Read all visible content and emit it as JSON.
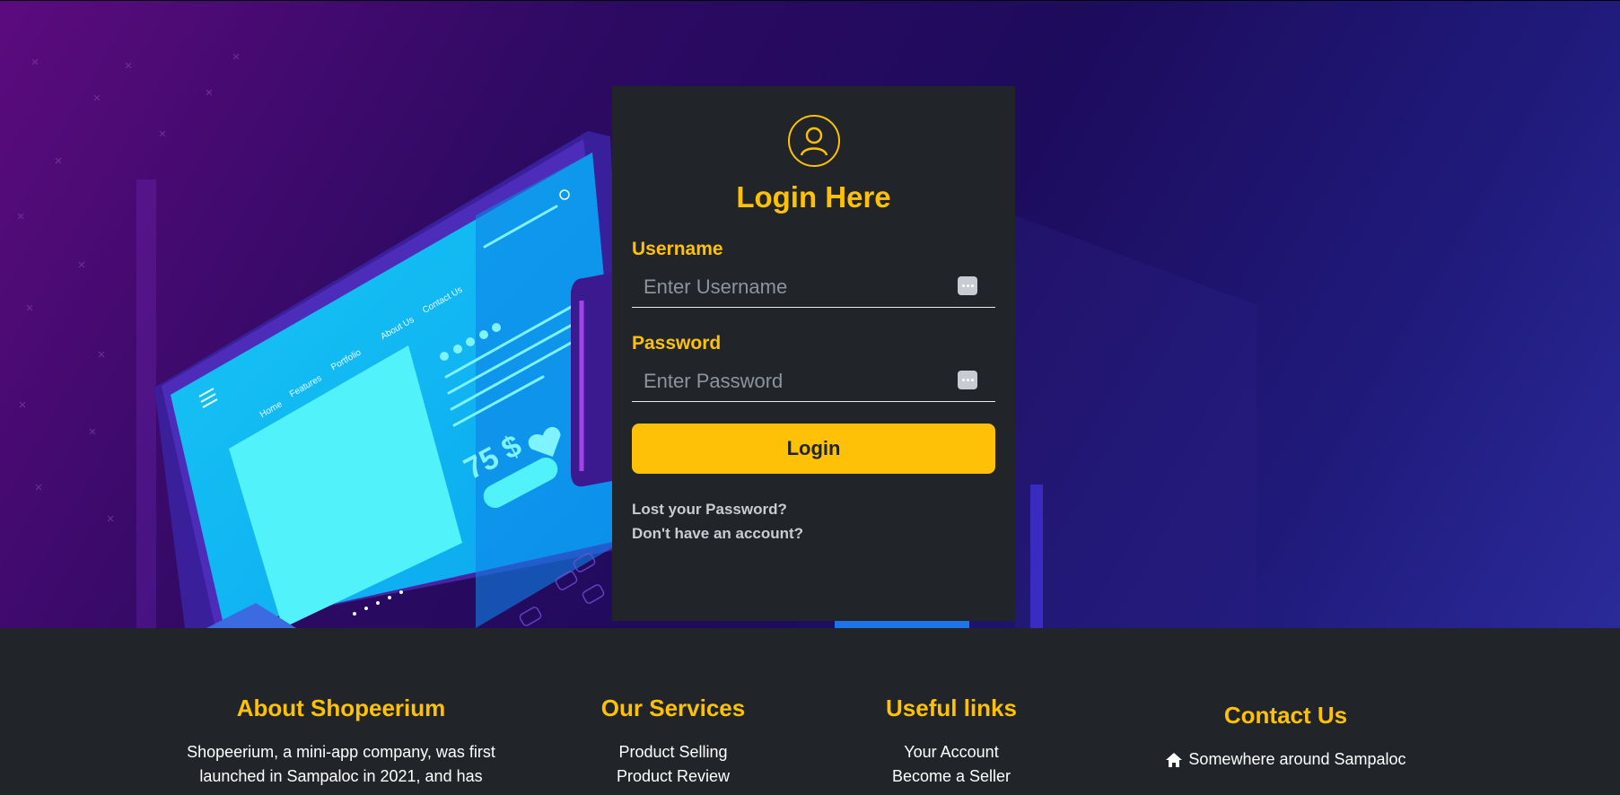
{
  "login": {
    "title": "Login Here",
    "username_label": "Username",
    "username_placeholder": "Enter Username",
    "password_label": "Password",
    "password_placeholder": "Enter Password",
    "login_button": "Login",
    "lost_password": "Lost your Password?",
    "no_account": "Don't have an account?"
  },
  "illustration": {
    "nav": [
      "Home",
      "Features",
      "Portfolio",
      "About Us",
      "Contact Us"
    ],
    "price": "75 $"
  },
  "footer": {
    "about": {
      "title": "About Shopeerium",
      "text": "Shopeerium, a mini-app company, was first launched in Sampaloc in 2021, and has"
    },
    "services": {
      "title": "Our Services",
      "items": [
        "Product Selling",
        "Product Review"
      ]
    },
    "useful": {
      "title": "Useful links",
      "items": [
        "Your Account",
        "Become a Seller"
      ]
    },
    "contact": {
      "title": "Contact Us",
      "address": "Somewhere around Sampaloc"
    }
  },
  "colors": {
    "accent": "#ffc107",
    "card_bg": "#212529",
    "footer_bg": "#212529"
  }
}
